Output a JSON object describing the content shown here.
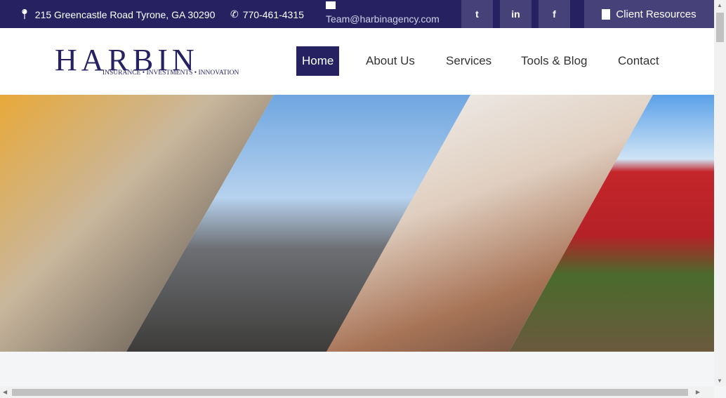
{
  "topbar": {
    "address": "215 Greencastle Road Tyrone, GA 30290",
    "phone": "770-461-4315",
    "email": "Team@harbinagency.com",
    "social": [
      {
        "icon": "twitter-icon",
        "glyph": "t"
      },
      {
        "icon": "linkedin-icon",
        "glyph": "in"
      },
      {
        "icon": "facebook-icon",
        "glyph": "f"
      }
    ],
    "client_resources": "Client Resources"
  },
  "logo": {
    "name": "HARBIN",
    "tagline": "INSURANCE • INVESTMENTS • INNOVATION"
  },
  "nav": [
    {
      "label": "Home",
      "active": true
    },
    {
      "label": "About Us"
    },
    {
      "label": "Services"
    },
    {
      "label": "Tools & Blog"
    },
    {
      "label": "Contact"
    }
  ],
  "colors": {
    "brand": "#262262",
    "social_bg": "#47417a"
  }
}
